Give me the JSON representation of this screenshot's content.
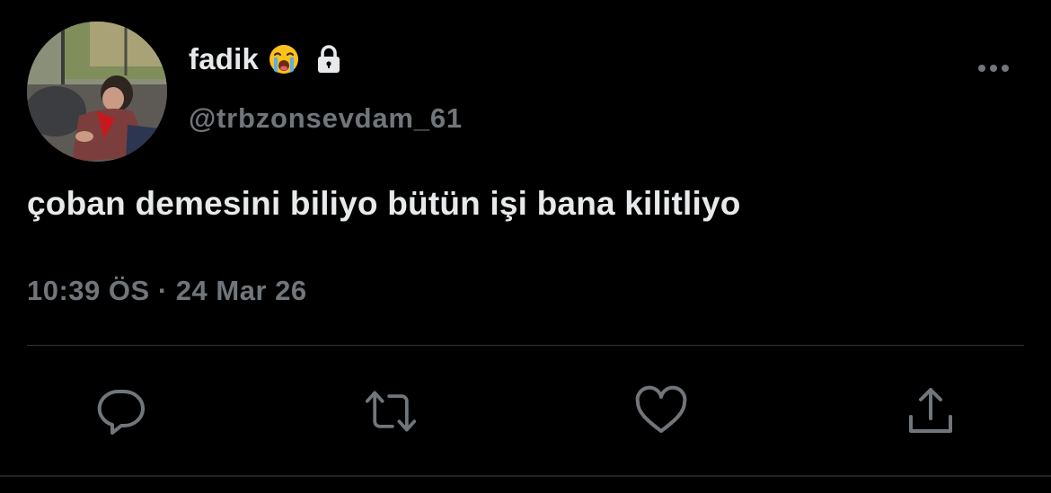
{
  "user": {
    "display_name": "fadik",
    "name_emoji": "loudly-crying-face-emoji",
    "protected_icon": "lock-icon",
    "handle": "@trbzonsevdam_61",
    "avatar": "profile-photo"
  },
  "tweet": {
    "text": "çoban demesini biliyo bütün işi bana kilitliyo",
    "time": "10:39 ÖS",
    "separator": "·",
    "date": "24 Mar 26"
  },
  "actions": [
    {
      "icon": "reply-icon"
    },
    {
      "icon": "retweet-icon"
    },
    {
      "icon": "like-icon"
    },
    {
      "icon": "share-icon"
    }
  ],
  "menu": {
    "icon": "more-options-icon"
  },
  "colors": {
    "background": "#000000",
    "primary_text": "#e7e9ea",
    "secondary_text": "#71767b",
    "divider": "#2f3336"
  }
}
